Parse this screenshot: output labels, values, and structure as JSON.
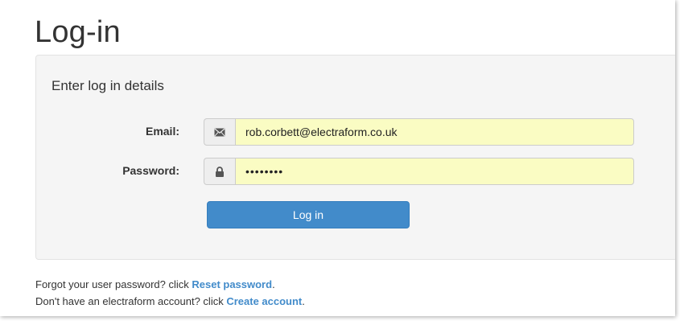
{
  "page": {
    "title": "Log-in"
  },
  "panel": {
    "heading": "Enter log in details"
  },
  "form": {
    "email": {
      "label": "Email:",
      "value": "rob.corbett@electraform.co.uk",
      "icon": "envelope-icon"
    },
    "password": {
      "label": "Password:",
      "value": "••••••••",
      "icon": "lock-icon"
    },
    "submit_label": "Log in"
  },
  "footer": {
    "forgot_prefix": "Forgot your user password? click ",
    "forgot_link": "Reset password",
    "forgot_suffix": ".",
    "create_prefix": "Don't have an electraform account? click ",
    "create_link": "Create account",
    "create_suffix": "."
  },
  "colors": {
    "accent": "#428bca",
    "autofill_background": "#fafcc3",
    "panel_background": "#f5f5f5"
  }
}
